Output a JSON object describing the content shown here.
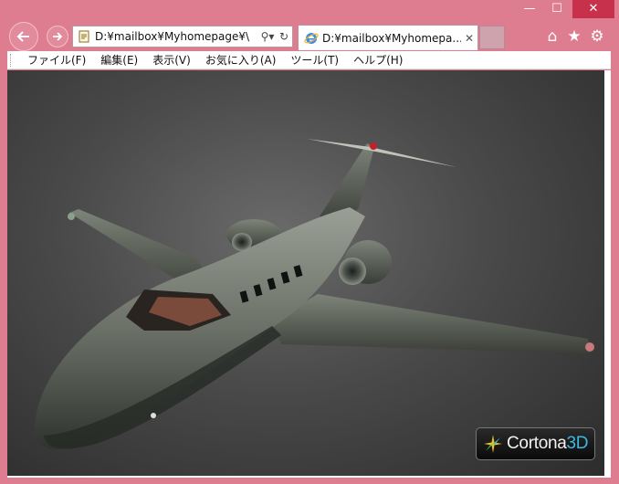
{
  "window": {
    "minimize": "—",
    "maximize": "☐",
    "close": "✕"
  },
  "nav": {
    "back": "back",
    "forward": "forward"
  },
  "address": {
    "url": "D:¥mailbox¥Myhomepage¥\\",
    "search_tool": "⚲▾",
    "refresh": "↻"
  },
  "tab": {
    "title": "D:¥mailbox¥Myhomepa...",
    "close": "✕"
  },
  "toolbar": {
    "home": "⌂",
    "favorites": "★",
    "settings": "⚙"
  },
  "menu": [
    {
      "label": "ファイル(F)"
    },
    {
      "label": "編集(E)"
    },
    {
      "label": "表示(V)"
    },
    {
      "label": "お気に入り(A)"
    },
    {
      "label": "ツール(T)"
    },
    {
      "label": "ヘルプ(H)"
    }
  ],
  "viewer": {
    "logo_main": "Cortona",
    "logo_suffix": "3D"
  },
  "colors": {
    "frame": "#de7d8f",
    "close_button": "#c7314b",
    "logo_accent": "#3cb9e6"
  }
}
